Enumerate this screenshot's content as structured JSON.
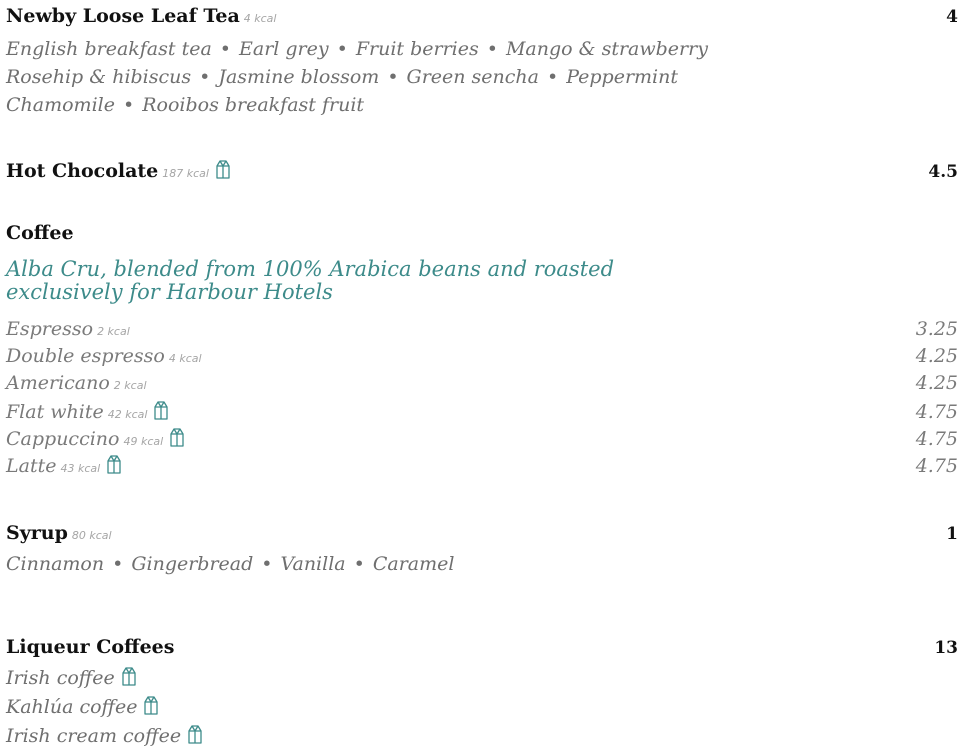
{
  "tea": {
    "title": "Newby Loose Leaf Tea",
    "kcal": "4 kcal",
    "price": "4",
    "line1": [
      "English breakfast tea",
      "Earl grey",
      "Fruit berries",
      "Mango & strawberry"
    ],
    "line2": [
      "Rosehip & hibiscus",
      "Jasmine blossom",
      "Green sencha",
      "Peppermint"
    ],
    "line3": [
      "Chamomile",
      "Rooibos breakfast fruit"
    ]
  },
  "hot_chocolate": {
    "title": "Hot Chocolate",
    "kcal": "187 kcal",
    "price": "4.5"
  },
  "coffee": {
    "title": "Coffee",
    "subtitle_line1": "Alba Cru, blended from 100% Arabica beans and roasted",
    "subtitle_line2": "exclusively for Harbour Hotels",
    "items": [
      {
        "name": "Espresso",
        "kcal": "2 kcal",
        "price": "3.25"
      },
      {
        "name": "Double espresso",
        "kcal": "4 kcal",
        "price": "4.25"
      },
      {
        "name": "Americano",
        "kcal": "2 kcal",
        "price": "4.25"
      },
      {
        "name": "Flat white",
        "kcal": "42 kcal",
        "price": "4.75"
      },
      {
        "name": "Cappuccino",
        "kcal": "49 kcal",
        "price": "4.75"
      },
      {
        "name": "Latte",
        "kcal": "43 kcal",
        "price": "4.75"
      }
    ]
  },
  "syrup": {
    "title": "Syrup",
    "kcal": "80 kcal",
    "price": "1",
    "flavours": [
      "Cinnamon",
      "Gingerbread",
      "Vanilla",
      "Caramel"
    ]
  },
  "liqueur": {
    "title": "Liqueur Coffees",
    "price": "13",
    "items": [
      "Irish coffee",
      "Kahlúa coffee",
      "Irish cream coffee"
    ]
  },
  "separator": "•",
  "icons": {
    "milk": "milk-carton-icon"
  },
  "colors": {
    "accent": "#3d8b8a",
    "text": "#111111",
    "muted": "#7a7a7a",
    "kcal": "#a5a5a5"
  }
}
